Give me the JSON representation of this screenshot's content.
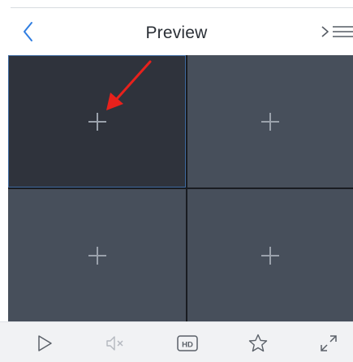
{
  "header": {
    "title": "Preview",
    "back_icon": "chevron-left-icon",
    "menu_icon": "list-menu-icon"
  },
  "grid": {
    "cells": [
      {
        "label": "+",
        "state": "selected"
      },
      {
        "label": "+",
        "state": "empty"
      },
      {
        "label": "+",
        "state": "empty"
      },
      {
        "label": "+",
        "state": "empty"
      }
    ],
    "annotation_arrow_color": "#e8211c"
  },
  "toolbar": {
    "hd_label": "HD",
    "icons": [
      "play-icon",
      "mute-icon",
      "hd-icon",
      "favorite-star-icon",
      "fullscreen-icon"
    ]
  },
  "colors": {
    "accent": "#2f7de1",
    "selected_cell": "#2f333c",
    "empty_cell": "#474f5b",
    "toolbar_bg": "#f1f2f4"
  }
}
